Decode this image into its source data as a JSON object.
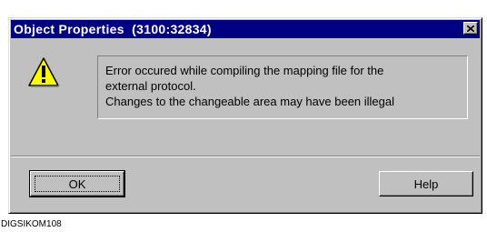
{
  "dialog": {
    "title": "Object Properties  (3100:32834)",
    "close_icon": "close-x-icon",
    "message_icon": "warning-triangle-icon",
    "message_lines": [
      " Error occured while compiling the mapping file for the",
      "external protocol.",
      "Changes to the changeable area may have been illegal"
    ],
    "buttons": {
      "ok_label": "OK",
      "help_label": "Help"
    }
  },
  "caption": "DIGSIKOM108",
  "colors": {
    "titlebar": "#000080",
    "face": "#c0c0c0",
    "warning_fill": "#ffff00"
  }
}
